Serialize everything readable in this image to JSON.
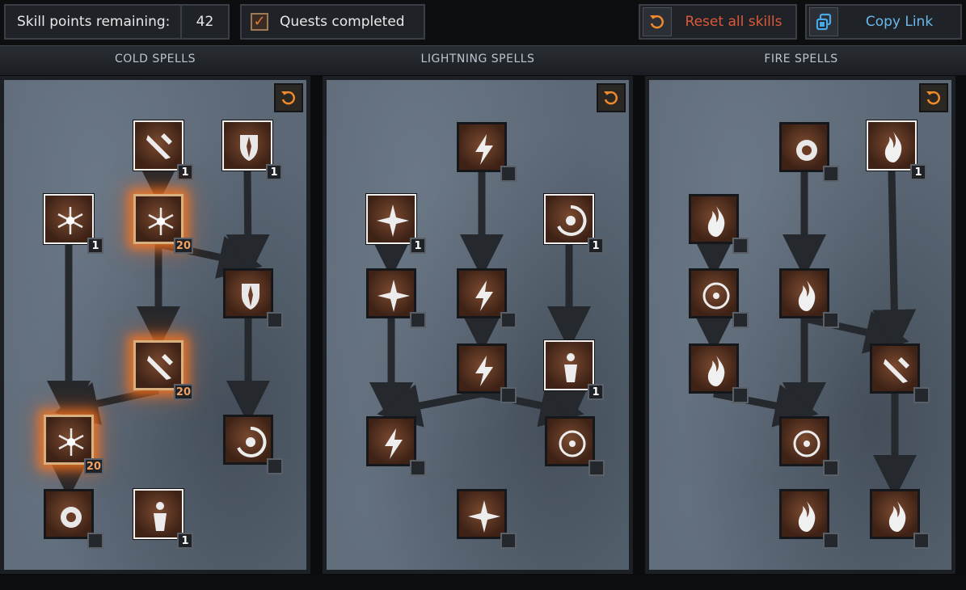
{
  "header": {
    "skill_points_label": "Skill points remaining:",
    "skill_points_value": "42",
    "quests_label": "Quests completed",
    "quests_checked": true,
    "reset_all_label": "Reset all skills",
    "copy_link_label": "Copy Link"
  },
  "columns": [
    {
      "title": "COLD SPELLS",
      "skills": [
        {
          "icon": "ice-bolt-icon",
          "rank": "1",
          "state": "learned"
        },
        {
          "icon": "frozen-armor-icon",
          "rank": "1",
          "state": "learned"
        },
        {
          "icon": "frost-nova-icon",
          "rank": "1",
          "state": "learned"
        },
        {
          "icon": "ice-blast-icon",
          "rank": "20",
          "state": "maxed"
        },
        {
          "icon": "shiver-armor-icon",
          "rank": "",
          "state": "empty"
        },
        {
          "icon": "glacial-spike-icon",
          "rank": "20",
          "state": "maxed"
        },
        {
          "icon": "blizzard-icon",
          "rank": "20",
          "state": "maxed"
        },
        {
          "icon": "chilling-armor-icon",
          "rank": "",
          "state": "empty"
        },
        {
          "icon": "frozen-orb-icon",
          "rank": "",
          "state": "empty"
        },
        {
          "icon": "cold-mastery-icon",
          "rank": "1",
          "state": "learned"
        }
      ]
    },
    {
      "title": "LIGHTNING SPELLS",
      "skills": [
        {
          "icon": "charged-bolt-icon",
          "rank": "",
          "state": "empty"
        },
        {
          "icon": "static-field-icon",
          "rank": "1",
          "state": "learned"
        },
        {
          "icon": "telekinesis-icon",
          "rank": "1",
          "state": "learned"
        },
        {
          "icon": "nova-icon",
          "rank": "",
          "state": "empty"
        },
        {
          "icon": "lightning-icon",
          "rank": "",
          "state": "empty"
        },
        {
          "icon": "chain-lightning-icon",
          "rank": "",
          "state": "empty"
        },
        {
          "icon": "teleport-icon",
          "rank": "1",
          "state": "learned"
        },
        {
          "icon": "thunder-storm-icon",
          "rank": "",
          "state": "empty"
        },
        {
          "icon": "energy-shield-icon",
          "rank": "",
          "state": "empty"
        },
        {
          "icon": "lightning-mastery-icon",
          "rank": "",
          "state": "empty"
        }
      ]
    },
    {
      "title": "FIRE SPELLS",
      "skills": [
        {
          "icon": "fire-bolt-icon",
          "rank": "",
          "state": "empty"
        },
        {
          "icon": "warmth-icon",
          "rank": "1",
          "state": "learned"
        },
        {
          "icon": "inferno-icon",
          "rank": "",
          "state": "empty"
        },
        {
          "icon": "blaze-icon",
          "rank": "",
          "state": "empty"
        },
        {
          "icon": "fire-ball-icon",
          "rank": "",
          "state": "empty"
        },
        {
          "icon": "fire-wall-icon",
          "rank": "",
          "state": "empty"
        },
        {
          "icon": "enchant-icon",
          "rank": "",
          "state": "empty"
        },
        {
          "icon": "meteor-icon",
          "rank": "",
          "state": "empty"
        },
        {
          "icon": "fire-mastery-icon",
          "rank": "",
          "state": "empty"
        },
        {
          "icon": "hydra-icon",
          "rank": "",
          "state": "empty"
        }
      ]
    }
  ],
  "colors": {
    "accent_orange": "#f07a2a",
    "reset_text": "#e0583a",
    "link_text": "#6ab8ec",
    "panel_stone": "#5c6876"
  }
}
